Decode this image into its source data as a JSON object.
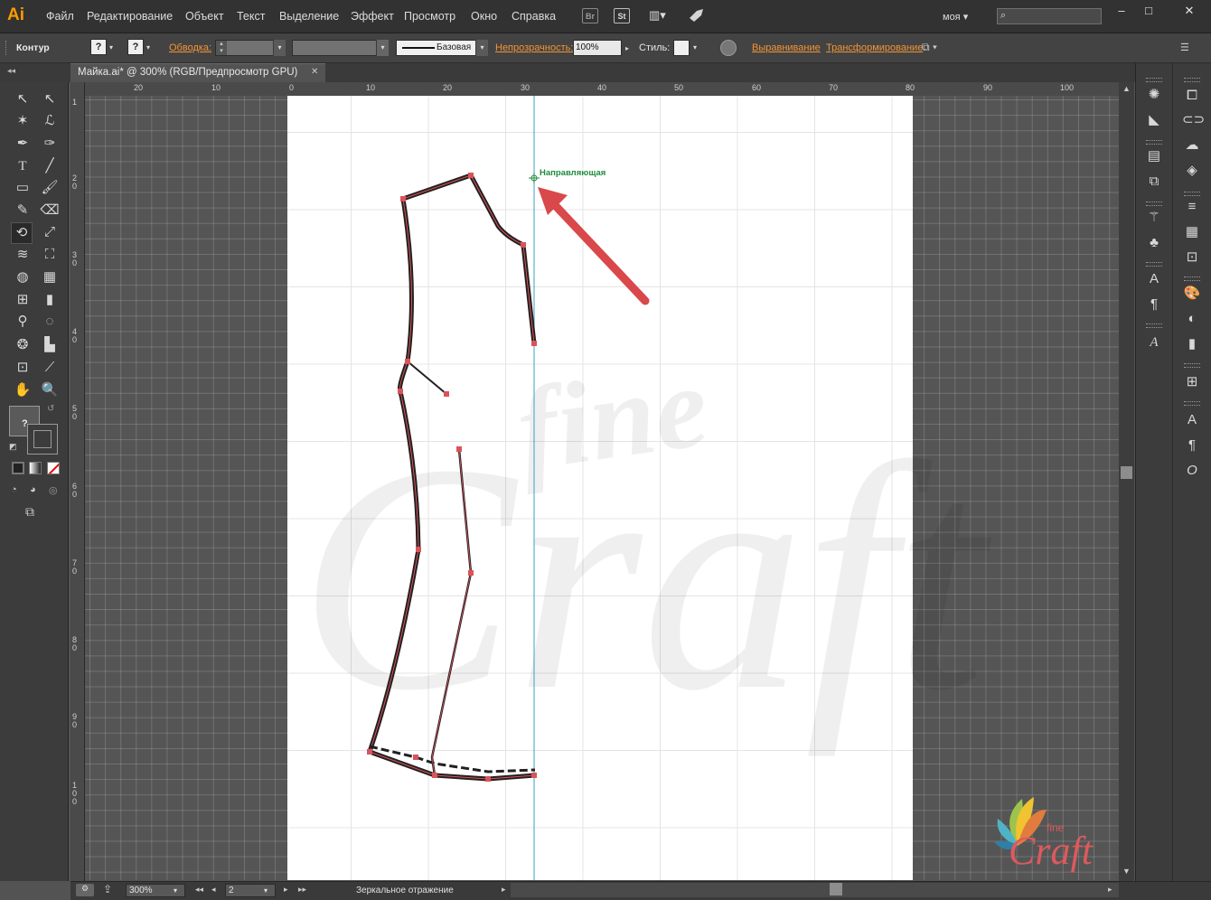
{
  "app": {
    "logo": "Ai",
    "accent": "#ff9a00"
  },
  "menu": [
    "Файл",
    "Редактирование",
    "Объект",
    "Текст",
    "Выделение",
    "Эффект",
    "Просмотр",
    "Окно",
    "Справка"
  ],
  "bridge_icons": [
    "Br",
    "St"
  ],
  "workspace": "моя",
  "window_controls": {
    "minimize": "–",
    "maximize": "□",
    "close": "✕"
  },
  "control_bar": {
    "selection_label": "Контур",
    "fill_value": "?",
    "stroke_value": "?",
    "stroke_label": "Обводка:",
    "stroke_style": "Базовая",
    "opacity_label": "Непрозрачность:",
    "opacity_value": "100%",
    "style_label": "Стиль:",
    "align_label": "Выравнивание",
    "transform_label": "Трансформирование"
  },
  "document_tab": {
    "title": "Майка.ai* @ 300% (RGB/Предпросмотр GPU)",
    "close": "✕"
  },
  "ruler_top": [
    "20",
    "10",
    "0",
    "10",
    "20",
    "30",
    "40",
    "50",
    "60",
    "70",
    "80",
    "90",
    "100"
  ],
  "ruler_left": [
    "1",
    "2",
    "3",
    "4",
    "5",
    "6",
    "7",
    "8",
    "9",
    "1"
  ],
  "ruler_left_sub": [
    "",
    "0",
    "0",
    "0",
    "0",
    "0",
    "0",
    "0",
    "0",
    "0"
  ],
  "ruler_left_sub2": [
    "",
    "",
    "",
    "",
    "",
    "",
    "",
    "",
    "",
    "0"
  ],
  "guide_label": "Направляющая",
  "watermark": {
    "word1": "fine",
    "word2": "Craft"
  },
  "status_bar": {
    "zoom": "300%",
    "artboard": "2",
    "status_text": "Зеркальное отражение",
    "nav_first": "◂◂",
    "nav_prev": "◂",
    "nav_next": "▸",
    "nav_last": "▸▸"
  },
  "tools_icons": [
    "selection-icon",
    "direct-selection-icon",
    "magic-wand-icon",
    "lasso-icon",
    "pen-icon",
    "curvature-icon",
    "type-icon",
    "line-icon",
    "rectangle-icon",
    "paintbrush-icon",
    "pencil-icon",
    "eraser-icon",
    "rotate-icon",
    "scale-icon",
    "warp-icon",
    "free-transform-icon",
    "shape-builder-icon",
    "perspective-icon",
    "mesh-icon",
    "gradient-icon",
    "eyedropper-icon",
    "blend-icon",
    "symbol-sprayer-icon",
    "column-graph-icon",
    "artboard-icon",
    "slice-icon",
    "hand-icon",
    "zoom-icon"
  ],
  "colors": {
    "pattern_stroke": "#231f20",
    "anchor": "#d9545a",
    "guide": "#3aa0c0",
    "arrow": "#d9484a",
    "accent_link": "#f29436",
    "watermark": "#dc5a5e"
  }
}
